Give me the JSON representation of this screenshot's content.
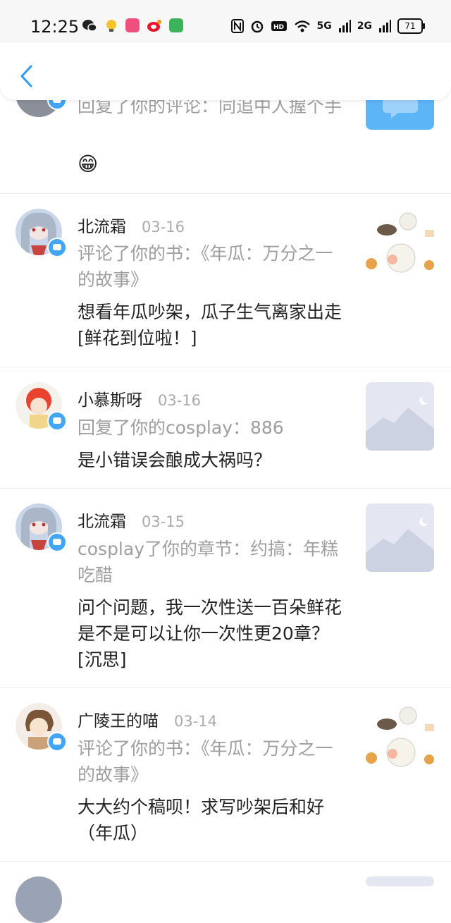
{
  "status_bar": {
    "time": "12:25",
    "net_5g": "5G",
    "net_2g": "2G",
    "battery": "71"
  },
  "nav": {
    "back_icon": "chevron-left-icon"
  },
  "items": [
    {
      "action": "回复了你的评论：同追中人握个手",
      "comment": "😁"
    },
    {
      "user": "北流霜",
      "date": "03-16",
      "action": "评论了你的书：《年瓜：万分之一的故事》",
      "comment": "想看年瓜吵架，瓜子生气离家出走[鲜花到位啦！]"
    },
    {
      "user": "小慕斯呀",
      "date": "03-16",
      "action": "回复了你的cosplay：886",
      "comment": "是小错误会酿成大祸吗？"
    },
    {
      "user": "北流霜",
      "date": "03-15",
      "action": "cosplay了你的章节：约搞：年糕吃醋",
      "comment": "问个问题，我一次性送一百朵鲜花是不是可以让你一次性更20章？[沉思]"
    },
    {
      "user": "广陵王的喵",
      "date": "03-14",
      "action": "评论了你的书：《年瓜：万分之一的故事》",
      "comment": "大大约个稿呗！求写吵架后和好（年瓜）"
    }
  ],
  "colors": {
    "accent": "#42a5f5",
    "secondary_text": "#9e9e9e",
    "divider": "#ececec"
  }
}
